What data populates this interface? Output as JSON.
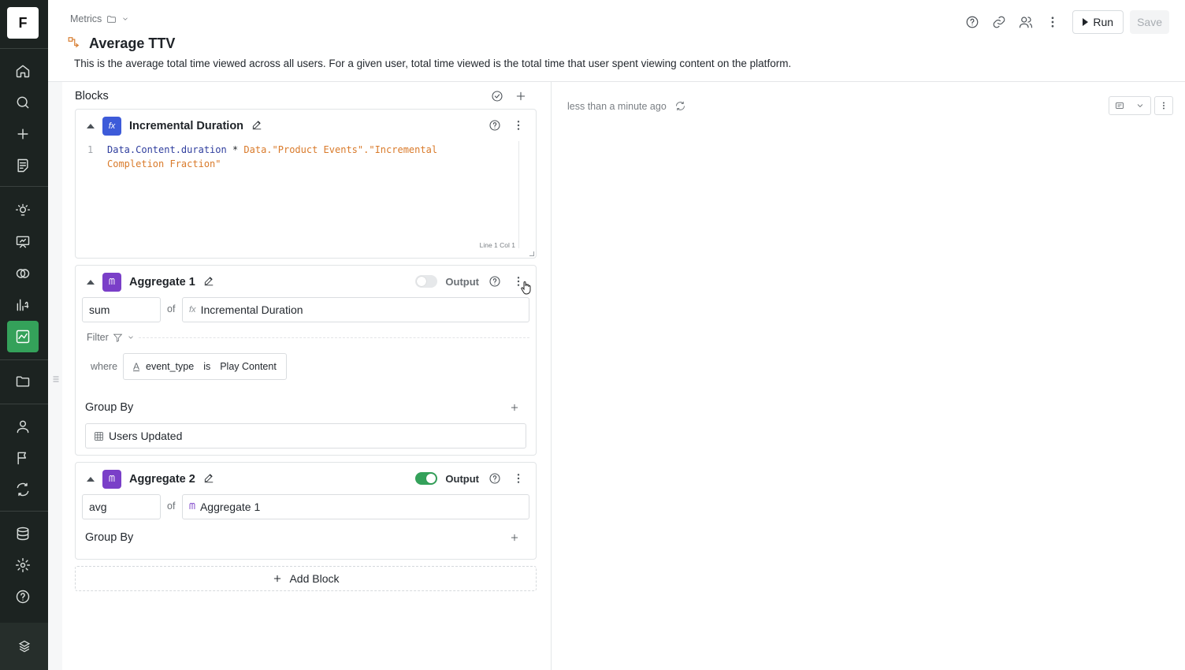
{
  "app": {
    "logo_letter": "F",
    "accent": "#34a15a"
  },
  "sidebar": {
    "items": [
      {
        "icon": "home-icon"
      },
      {
        "icon": "search-icon"
      },
      {
        "icon": "plus-icon"
      },
      {
        "icon": "notebook-icon"
      },
      {
        "icon": "lightbulb-icon"
      },
      {
        "icon": "presentation-icon"
      },
      {
        "icon": "segments-icon"
      },
      {
        "icon": "formula-icon"
      },
      {
        "icon": "metrics-icon",
        "active": true
      },
      {
        "icon": "folder-icon"
      },
      {
        "icon": "user-icon"
      },
      {
        "icon": "flag-icon"
      },
      {
        "icon": "experiment-icon"
      },
      {
        "icon": "database-icon"
      },
      {
        "icon": "gear-icon"
      },
      {
        "icon": "help-icon"
      }
    ]
  },
  "header": {
    "breadcrumb": "Metrics",
    "title": "Average TTV",
    "description": "This is the average total time viewed across all users. For a given user, total time viewed is the total time that user spent viewing content on the platform.",
    "run_label": "Run",
    "save_label": "Save"
  },
  "blocks_panel": {
    "heading": "Blocks",
    "add_block_label": "Add Block",
    "formula_block": {
      "title": "Incremental Duration",
      "line_number": "1",
      "code_part1": "Data.Content.duration",
      "code_op": " * ",
      "code_part2": "Data.\"Product Events\".\"Incremental",
      "code_line2": "Completion Fraction\"",
      "status": "Line 1 Col 1"
    },
    "aggregate1": {
      "title": "Aggregate 1",
      "output_label": "Output",
      "output_on": false,
      "func": "sum",
      "of": "of",
      "source": "Incremental Duration",
      "filter_label": "Filter",
      "where_label": "where",
      "condition": {
        "column": "event_type",
        "operator": "is",
        "value": "Play Content"
      },
      "group_by_label": "Group By",
      "group_by_value": "Users Updated"
    },
    "aggregate2": {
      "title": "Aggregate 2",
      "output_label": "Output",
      "output_on": true,
      "func": "avg",
      "of": "of",
      "source": "Aggregate 1",
      "group_by_label": "Group By"
    }
  },
  "result_panel": {
    "updated": "less than a minute ago"
  }
}
